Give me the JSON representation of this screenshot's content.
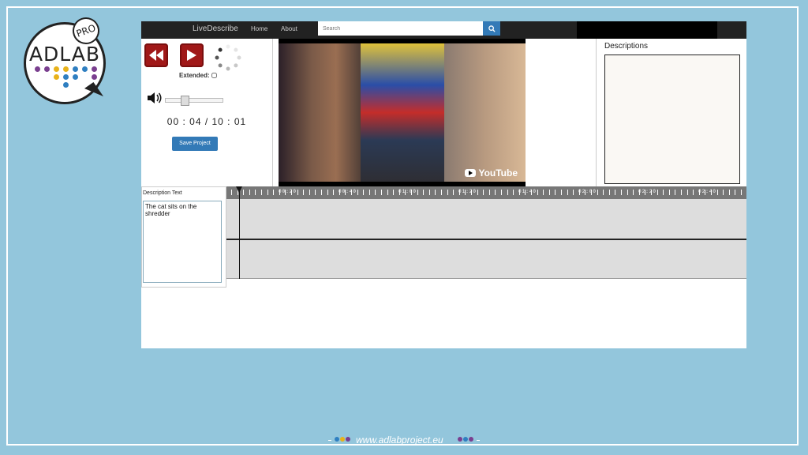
{
  "logo": {
    "text": "ADLAB",
    "badge": "PRO"
  },
  "navbar": {
    "brand": "LiveDescribe",
    "links": [
      "Home",
      "About"
    ],
    "search_placeholder": "Search"
  },
  "controls": {
    "extended_label": "Extended:",
    "extended_checked": false,
    "timecode": "00 : 04 / 10 : 01",
    "save_label": "Save Project",
    "volume_level": 0.3
  },
  "video": {
    "watermark": "YouTube"
  },
  "descriptions": {
    "title": "Descriptions"
  },
  "description_text": {
    "label": "Description Text",
    "value": "The cat sits on the shredder"
  },
  "timeline": {
    "labels": [
      "00:20",
      "00:40",
      "01:00",
      "01:20",
      "01:40",
      "02:00",
      "02:20",
      "02:40"
    ]
  },
  "footer": {
    "url": "www.adlabproject.eu"
  },
  "colors": {
    "background": "#93c6dc",
    "accent": "#337ab7",
    "play_red": "#a01818"
  }
}
